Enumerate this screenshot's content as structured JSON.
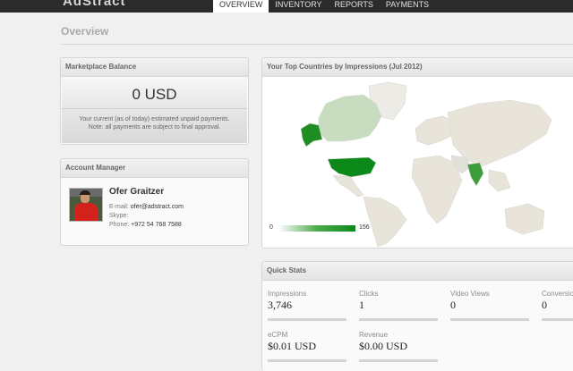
{
  "brand": {
    "logo_text": "AdStract"
  },
  "nav": {
    "items": [
      {
        "label": "OVERVIEW",
        "active": true
      },
      {
        "label": "INVENTORY"
      },
      {
        "label": "REPORTS"
      },
      {
        "label": "PAYMENTS"
      }
    ]
  },
  "page": {
    "title": "Overview"
  },
  "balance": {
    "header": "Marketplace Balance",
    "amount": "0 USD",
    "note_line1": "Your current (as of today) estimated unpaid payments.",
    "note_line2": "Note: all payments are subject to final approval."
  },
  "account_manager": {
    "header": "Account Manager",
    "name": "Ofer Graitzer",
    "email_label": "E-mail:",
    "email": "ofer@adstract.com",
    "skype_label": "Skype:",
    "skype": "",
    "phone_label": "Phone:",
    "phone": "+972 54 768 7588"
  },
  "top_countries": {
    "header": "Your Top Countries by Impressions (Jul 2012)",
    "legend_min": "0",
    "legend_max": "156",
    "colors": {
      "land": "#e8e4da",
      "highlight_high": "#0b8a1a",
      "highlight_mid": "#3c9e3a",
      "highlight_low": "#c8dcc0"
    }
  },
  "quick_stats": {
    "header": "Quick Stats",
    "items": [
      {
        "label": "Impressions",
        "value": "3,746"
      },
      {
        "label": "Clicks",
        "value": "1"
      },
      {
        "label": "Video Views",
        "value": "0"
      },
      {
        "label": "Conversions",
        "value": "0"
      },
      {
        "label": "eCPM",
        "value": "$0.01 USD"
      },
      {
        "label": "Revenue",
        "value": "$0.00 USD"
      }
    ]
  }
}
